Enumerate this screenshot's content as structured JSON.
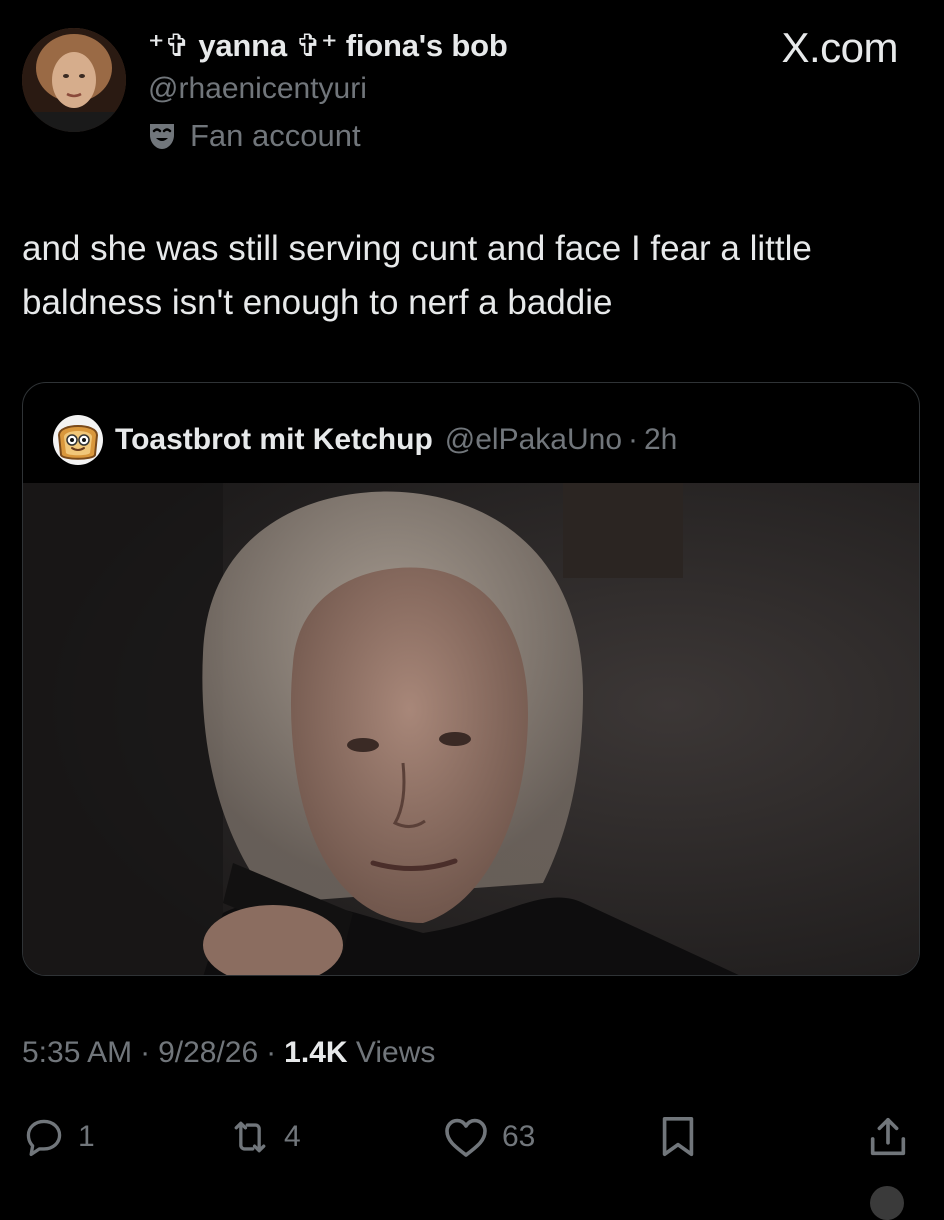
{
  "author": {
    "display_name": "⁺✞ yanna ✞⁺ fiona's bob",
    "handle": "@rhaenicentyuri",
    "badge_icon": "theater-mask-icon",
    "badge_label": "Fan account"
  },
  "site_label": "X.com",
  "tweet": {
    "text": "and she was still serving cunt and face I fear a little baldness isn't enough to nerf a baddie"
  },
  "quote": {
    "name": "Toastbrot mit Ketchup",
    "handle": "@elPakaUno",
    "dot": "·",
    "time": "2h",
    "avatar_icon": "toast-face-icon"
  },
  "meta": {
    "time": "5:35 AM",
    "dot1": "·",
    "date": "9/28/26",
    "dot2": "·",
    "views_count": "1.4K",
    "views_label": "Views"
  },
  "actions": {
    "reply_count": "1",
    "retweet_count": "4",
    "like_count": "63"
  },
  "colors": {
    "background": "#000000",
    "text_primary": "#e7e9ea",
    "text_secondary": "#71767b",
    "border": "#2f3336"
  }
}
